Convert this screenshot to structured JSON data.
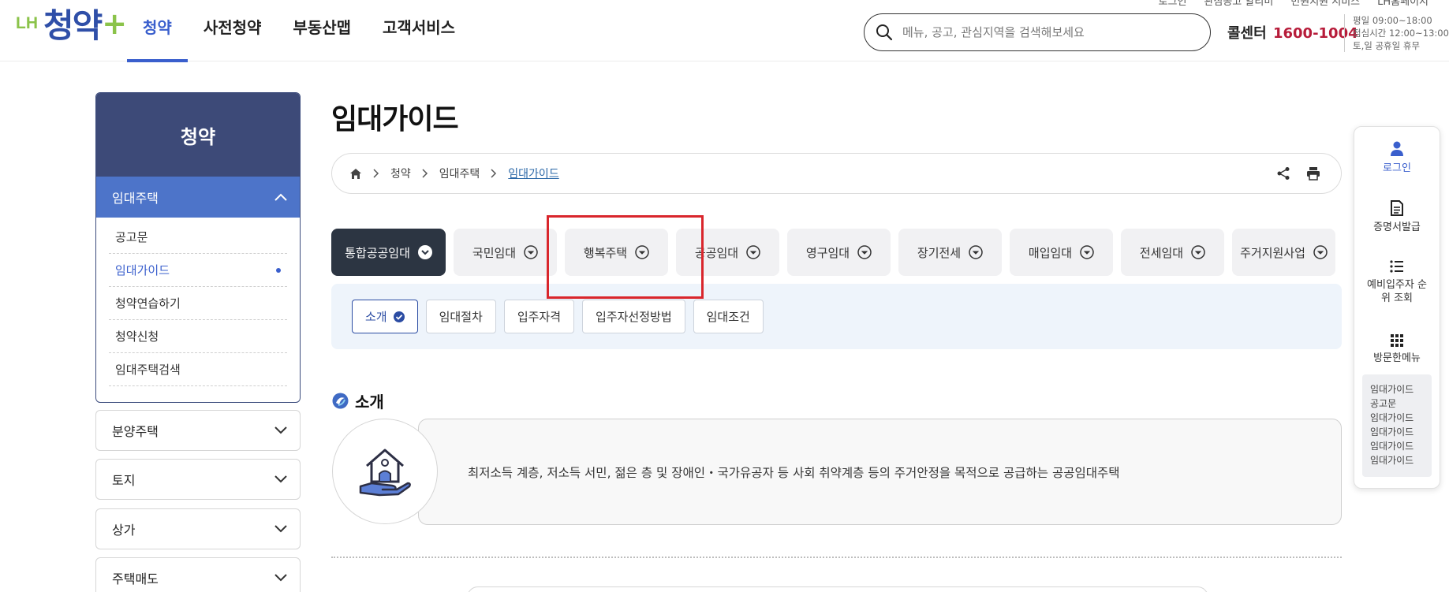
{
  "header": {
    "util_links": [
      "로그인",
      "관심공고 알리미",
      "민원지원 서비스",
      "LH홈페이지"
    ],
    "logo": {
      "prefix": "LH",
      "name": "청약",
      "plus": "+"
    },
    "gnb": [
      {
        "label": "청약",
        "active": true
      },
      {
        "label": "사전청약",
        "active": false
      },
      {
        "label": "부동산맵",
        "active": false
      },
      {
        "label": "고객서비스",
        "active": false
      }
    ],
    "search": {
      "placeholder": "메뉴, 공고, 관심지역을 검색해보세요",
      "value": ""
    },
    "callcenter": {
      "label": "콜센터",
      "number": "1600-1004"
    },
    "hours": [
      "평일 09:00~18:00",
      "점심시간 12:00~13:00",
      "토,일 공휴일 휴무"
    ]
  },
  "sidebar": {
    "title": "청약",
    "selected": "임대주택",
    "items": [
      {
        "label": "공고문",
        "active": false
      },
      {
        "label": "임대가이드",
        "active": true
      },
      {
        "label": "청약연습하기",
        "active": false
      },
      {
        "label": "청약신청",
        "active": false
      },
      {
        "label": "임대주택검색",
        "active": false
      }
    ],
    "categories": [
      "분양주택",
      "토지",
      "상가",
      "주택매도"
    ]
  },
  "main": {
    "title": "임대가이드",
    "breadcrumb": [
      "청약",
      "임대주택",
      "임대가이드"
    ],
    "tabs": [
      {
        "label": "통합공공임대",
        "active": true
      },
      {
        "label": "국민임대",
        "active": false
      },
      {
        "label": "행복주택",
        "active": false
      },
      {
        "label": "공공임대",
        "active": false
      },
      {
        "label": "영구임대",
        "active": false
      },
      {
        "label": "장기전세",
        "active": false
      },
      {
        "label": "매입임대",
        "active": false
      },
      {
        "label": "전세임대",
        "active": false
      },
      {
        "label": "주거지원사업",
        "active": false
      }
    ],
    "subtabs": [
      {
        "label": "소개",
        "active": true
      },
      {
        "label": "임대절차",
        "active": false
      },
      {
        "label": "입주자격",
        "active": false
      },
      {
        "label": "입주자선정방법",
        "active": false
      },
      {
        "label": "임대조건",
        "active": false
      }
    ],
    "section_title": "소개",
    "intro_text": "최저소득 계층, 저소득 서민, 젊은 층 및 장애인・국가유공자 등 사회 취약계층 등의 주거안정을 목적으로 공급하는 공공임대주택"
  },
  "quick_menu": {
    "items": [
      "로그인",
      "증명서발급",
      "예비입주자 순위 조회",
      "방문한메뉴"
    ],
    "visited": [
      "임대가이드",
      "공고문",
      "임대가이드",
      "임대가이드",
      "임대가이드",
      "임대가이드"
    ]
  },
  "colors": {
    "brand_blue": "#3a5fcd",
    "sidebar_dark": "#3d4a78",
    "sidebar_selected": "#4d74c9",
    "call_red": "#b71c3a",
    "highlight_red": "#d9262c",
    "tab_dark": "#2c3542"
  },
  "icons": [
    "search-icon",
    "chevron-up-icon",
    "chevron-down-icon",
    "home-icon",
    "share-icon",
    "print-icon",
    "circle-chevron-down-icon",
    "check-circle-icon",
    "intro-logo-icon",
    "house-hand-icon",
    "person-icon",
    "document-icon",
    "list-icon",
    "grid-icon"
  ]
}
